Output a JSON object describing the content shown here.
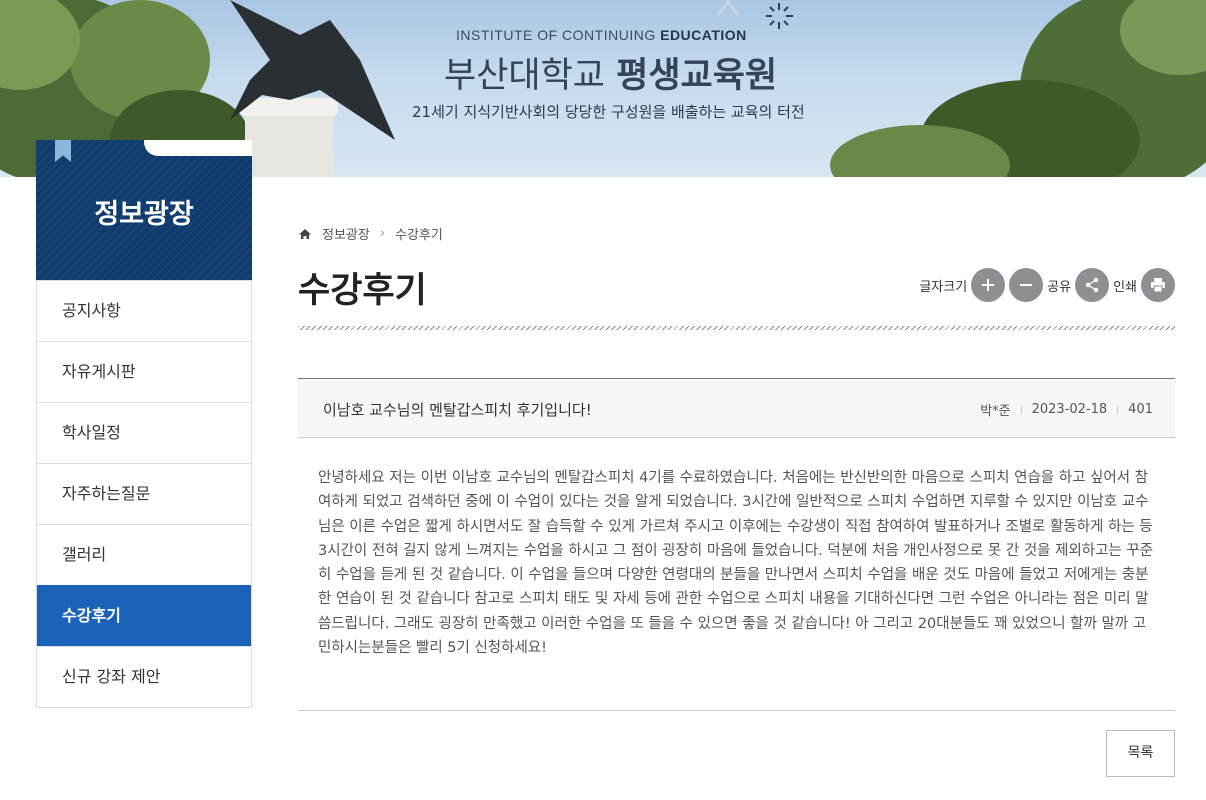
{
  "banner": {
    "institute_en_prefix": "INSTITUTE OF CONTINUING ",
    "institute_en_bold": "EDUCATION",
    "institute_ko_prefix": "부산대학교 ",
    "institute_ko_bold": "평생교육원",
    "slogan": "21세기 지식기반사회의 당당한 구성원을 배출하는 교육의 터전"
  },
  "sidebar": {
    "title": "정보광장",
    "items": [
      {
        "label": "공지사항",
        "active": false
      },
      {
        "label": "자유게시판",
        "active": false
      },
      {
        "label": "학사일정",
        "active": false
      },
      {
        "label": "자주하는질문",
        "active": false
      },
      {
        "label": "갤러리",
        "active": false
      },
      {
        "label": "수강후기",
        "active": true
      },
      {
        "label": "신규 강좌 제안",
        "active": false
      }
    ]
  },
  "breadcrumb": {
    "level1": "정보광장",
    "level2": "수강후기"
  },
  "page_title": "수강후기",
  "tools": {
    "font_size_label": "글자크기",
    "share_label": "공유",
    "print_label": "인쇄"
  },
  "post": {
    "title": "이남호 교수님의 멘탈갑스피치 후기입니다!",
    "author": "박*준",
    "date": "2023-02-18",
    "views": "401",
    "body": "안녕하세요 저는 이번 이남호 교수님의 멘탈갑스피치 4기를 수료하였습니다. 처음에는 반신반의한 마음으로 스피치 연습을 하고 싶어서 참여하게 되었고 검색하던 중에 이 수업이 있다는 것을 알게 되었습니다. 3시간에 일반적으로 스피치 수업하면 지루할 수 있지만 이남호 교수님은 이른 수업은 짧게 하시면서도 잘 습득할 수 있게 가르쳐 주시고 이후에는 수강생이 직접 참여하여 발표하거나 조별로 활동하게 하는 등 3시간이 전혀 길지 않게 느껴지는 수업을 하시고 그 점이 굉장히 마음에 들었습니다. 덕분에 처음 개인사정으로 못 간 것을 제외하고는 꾸준히 수업을 듣게 된 것 같습니다. 이 수업을 들으며 다양한 연령대의 분들을 만나면서 스피치 수업을 배운 것도 마음에 들었고 저에게는 충분한 연습이 된 것 같습니다 참고로 스피치 태도 및 자세 등에 관한 수업으로 스피치 내용을 기대하신다면 그런 수업은 아니라는 점은 미리 말씀드립니다. 그래도 굉장히 만족했고 이러한 수업을 또 들을 수 있으면 좋을 것 같습니다! 아 그리고 20대분들도 꽤 있었으니 할까 말까 고민하시는분들은 빨리 5기 신청하세요!"
  },
  "list_button": "목록"
}
